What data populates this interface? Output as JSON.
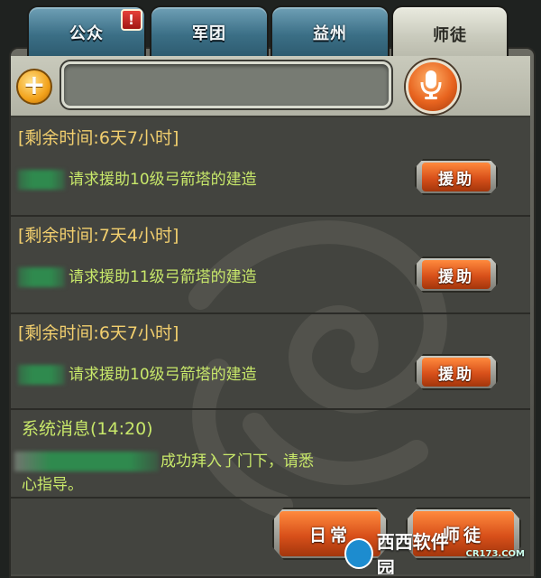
{
  "tabs": [
    {
      "label": "公众",
      "badge": "!"
    },
    {
      "label": "军团"
    },
    {
      "label": "益州"
    },
    {
      "label": "师徒",
      "active": true
    }
  ],
  "input": {
    "placeholder": ""
  },
  "messages": [
    {
      "time": "[剩余时间:6天7小时]",
      "text": "请求援助10级弓箭塔的建造",
      "button": "援助"
    },
    {
      "time": "[剩余时间:7天4小时]",
      "text": "请求援助11级弓箭塔的建造",
      "button": "援助"
    },
    {
      "time": "[剩余时间:6天7小时]",
      "text": "请求援助10级弓箭塔的建造",
      "button": "援助"
    }
  ],
  "system": {
    "title": "系统消息(14:20)",
    "line1": "成功拜入了门下，请悉",
    "line2": "心指导。"
  },
  "footer": {
    "daily": "日常",
    "master": "师徒"
  },
  "watermark": {
    "brand": "西西软件园",
    "site": "CR173.COM"
  }
}
